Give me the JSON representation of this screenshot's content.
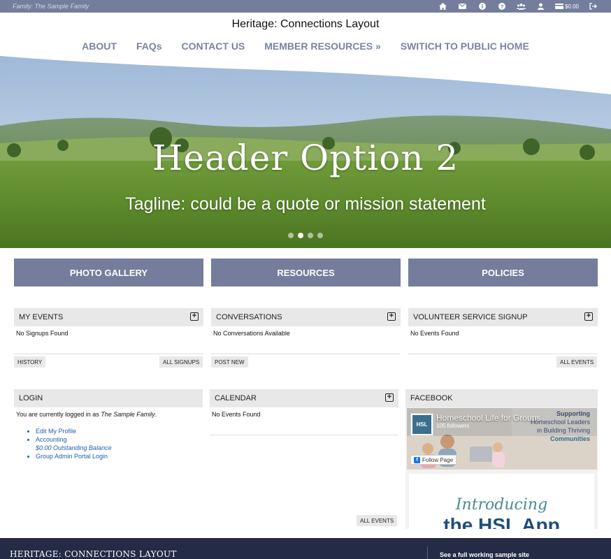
{
  "topbar": {
    "family": "Family: The Sample Family",
    "balance": "$0.00",
    "icons": [
      "home-icon",
      "mail-icon",
      "info-icon",
      "help-icon",
      "users-icon",
      "user-icon",
      "wallet-icon",
      "logout-icon"
    ]
  },
  "site_title": "Heritage: Connections Layout",
  "nav": {
    "items": [
      "ABOUT",
      "FAQs",
      "CONTACT US",
      "MEMBER RESOURCES »",
      "SWITICH TO PUBLIC HOME"
    ]
  },
  "hero": {
    "heading": "Header Option 2",
    "tagline": "Tagline: could be a quote or mission statement",
    "slide_count": 4,
    "active_slide": 2
  },
  "buttons": [
    "PHOTO GALLERY",
    "RESOURCES",
    "POLICIES"
  ],
  "panels": {
    "my_events": {
      "title": "MY EVENTS",
      "empty": "No Signups Found",
      "left_btn": "HISTORY",
      "right_btn": "ALL SIGNUPS"
    },
    "conversations": {
      "title": "CONVERSATIONS",
      "empty": "No Conversations Available",
      "left_btn": "POST NEW"
    },
    "volunteer": {
      "title": "VOLUNTEER SERVICE SIGNUP",
      "empty": "No Events Found",
      "right_btn": "ALL EVENTS"
    },
    "login": {
      "title": "LOGIN",
      "text_prefix": "You are currently logged in as ",
      "user": "The Sample Family",
      "text_suffix": ".",
      "links": [
        "Edit My Profile",
        "Accounting",
        "Group Admin Portal Login"
      ],
      "balance_note": "$0.00 Outstanding Balance"
    },
    "calendar": {
      "title": "CALENDAR",
      "empty": "No Events Found",
      "right_btn": "ALL EVENTS"
    },
    "facebook": {
      "title": "FACEBOOK",
      "page_name": "Homeschool Life for Groups",
      "followers": "105 followers",
      "follow": "Follow Page",
      "logo": "HSL",
      "banner_line1": "Supporting",
      "banner_line2": "Homeschool Leaders",
      "banner_line3": "in Building Thriving",
      "banner_line4": "Communities",
      "promo_script": "Introducing",
      "promo_big": "the HSL App"
    }
  },
  "footer": {
    "title": "HERITAGE: CONNECTIONS LAYOUT",
    "right": "See a full working sample site"
  },
  "colors": {
    "accent": "#747d9b",
    "footer": "#232b45",
    "link": "#1f5fa8"
  }
}
